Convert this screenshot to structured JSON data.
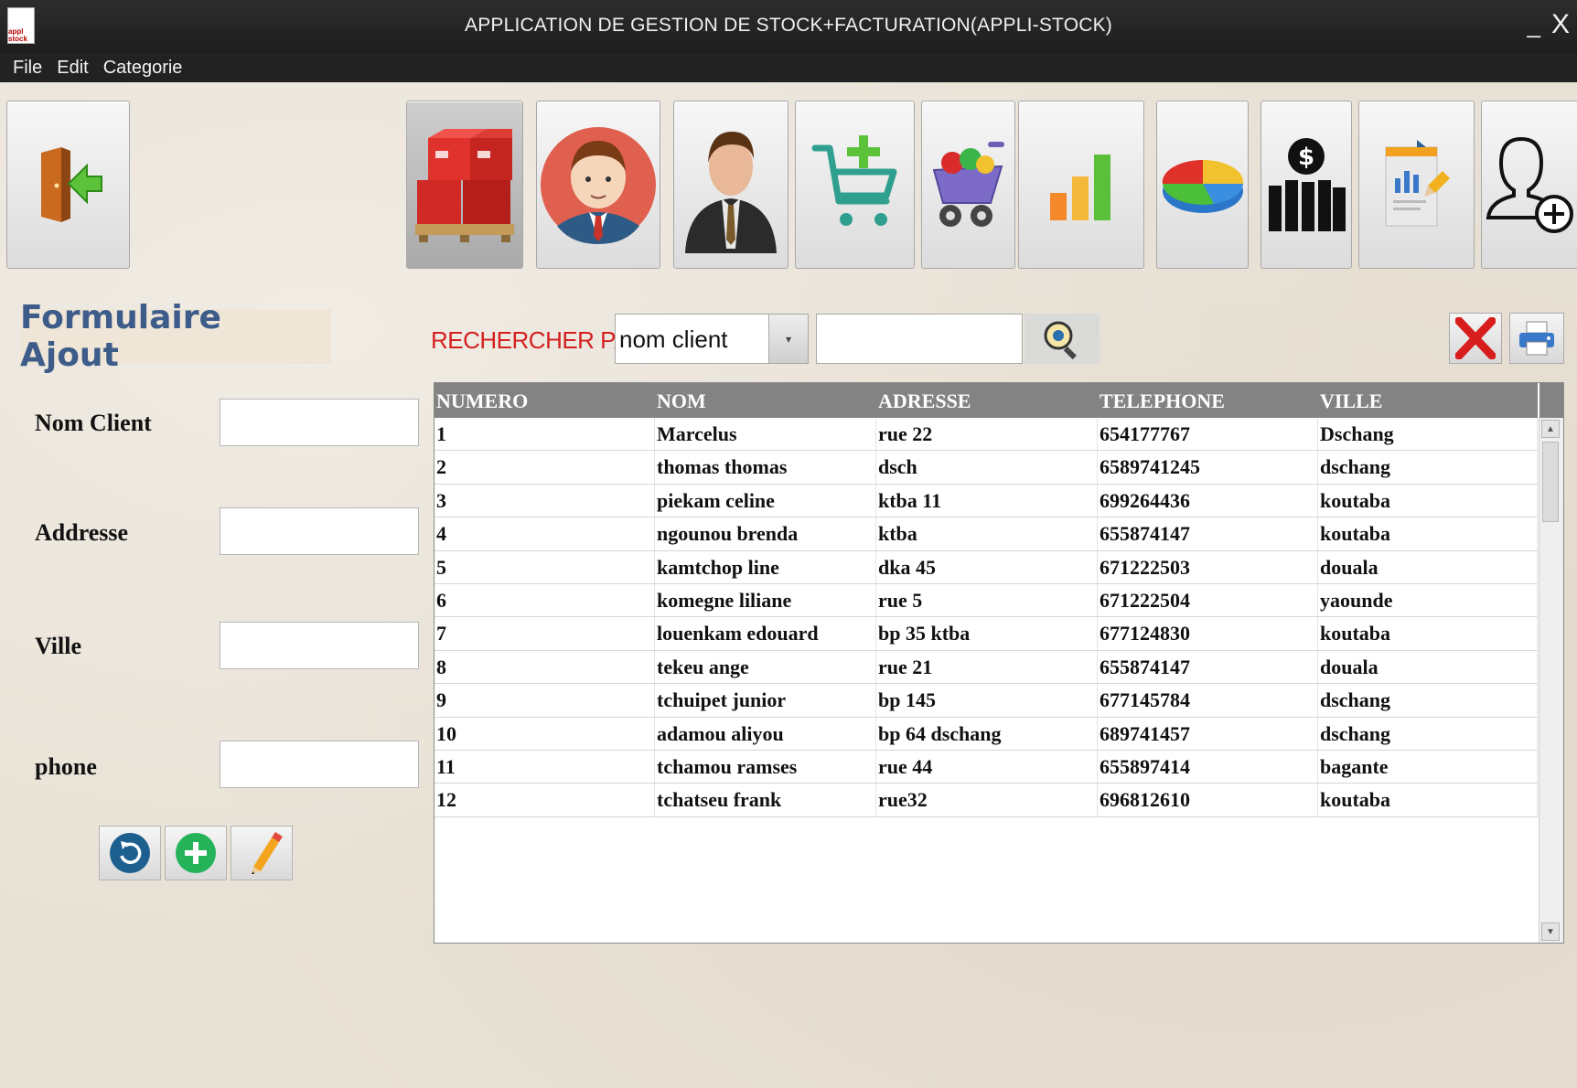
{
  "window": {
    "title": "APPLICATION DE GESTION DE STOCK+FACTURATION(APPLI-STOCK)",
    "app_icon_text": "appl stock",
    "minimize_glyph": "_",
    "close_glyph": "X"
  },
  "menu": [
    "File",
    "Edit",
    "Categorie"
  ],
  "toolbar": {
    "icons": [
      {
        "name": "logout-door-icon"
      },
      {
        "name": "stock-boxes-icon"
      },
      {
        "name": "client-avatar-icon"
      },
      {
        "name": "supplier-businessman-icon"
      },
      {
        "name": "add-to-cart-icon"
      },
      {
        "name": "shopping-cart-icon"
      },
      {
        "name": "bar-chart-icon"
      },
      {
        "name": "pie-chart-icon"
      },
      {
        "name": "finance-dollar-icon"
      },
      {
        "name": "report-edit-icon"
      },
      {
        "name": "add-user-icon"
      }
    ]
  },
  "form": {
    "title": "Formulaire Ajout",
    "fields": [
      {
        "label": "Nom Client",
        "value": ""
      },
      {
        "label": "Addresse",
        "value": ""
      },
      {
        "label": "Ville",
        "value": ""
      },
      {
        "label": "phone",
        "value": ""
      }
    ]
  },
  "search": {
    "label": "RECHERCHER PAR",
    "criteria_selected": "nom client",
    "query": ""
  },
  "table": {
    "columns": [
      "NUMERO",
      "NOM",
      "ADRESSE",
      "TELEPHONE",
      "VILLE"
    ],
    "rows": [
      [
        "1",
        "Marcelus",
        "rue 22",
        "654177767",
        "Dschang"
      ],
      [
        "2",
        "thomas thomas",
        "dsch",
        "6589741245",
        "dschang"
      ],
      [
        "3",
        "piekam celine",
        "ktba 11",
        "699264436",
        "koutaba"
      ],
      [
        "4",
        "ngounou brenda",
        "ktba",
        "655874147",
        "koutaba"
      ],
      [
        "5",
        "kamtchop line",
        "dka 45",
        "671222503",
        "douala"
      ],
      [
        "6",
        "komegne liliane",
        "rue 5",
        "671222504",
        "yaounde"
      ],
      [
        "7",
        "louenkam edouard",
        "bp 35 ktba",
        "677124830",
        "koutaba"
      ],
      [
        "8",
        "tekeu ange",
        "rue 21",
        "655874147",
        "douala"
      ],
      [
        "9",
        "tchuipet junior",
        "bp 145",
        "677145784",
        "dschang"
      ],
      [
        "10",
        "adamou aliyou",
        "bp 64 dschang",
        "689741457",
        "dschang"
      ],
      [
        "11",
        "tchamou ramses",
        "rue 44",
        "655897414",
        "bagante"
      ],
      [
        "12",
        "tchatseu frank",
        "rue32",
        "696812610",
        "koutaba"
      ]
    ]
  },
  "colors": {
    "titlebar": "#222222",
    "form_title": "#3d5c8a",
    "search_label": "#d42020",
    "table_header": "#838383"
  }
}
